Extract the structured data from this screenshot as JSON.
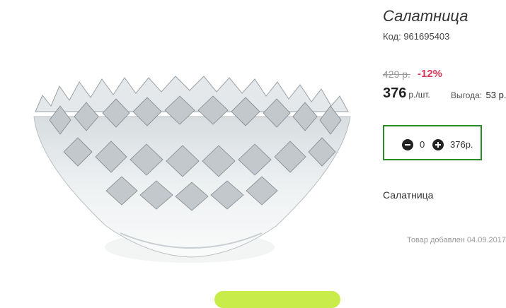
{
  "product": {
    "title": "Салатница",
    "code": "Код: 961695403",
    "name": "Салатница",
    "added_date": "Товар добавлен 04.09.2017"
  },
  "pricing": {
    "old_price": "429 р.",
    "discount": "-12%",
    "price": "376",
    "unit": "р./шт.",
    "savings_label": "Выгода:",
    "savings_value": "53 р."
  },
  "cart": {
    "quantity": "0",
    "total": "376р."
  },
  "icons": {
    "minus": "minus-circle-icon",
    "plus": "plus-circle-icon"
  },
  "colors": {
    "discount": "#d93a5a",
    "qty_border": "#2a8a2a",
    "accent_bar": "#c8ec4a"
  }
}
